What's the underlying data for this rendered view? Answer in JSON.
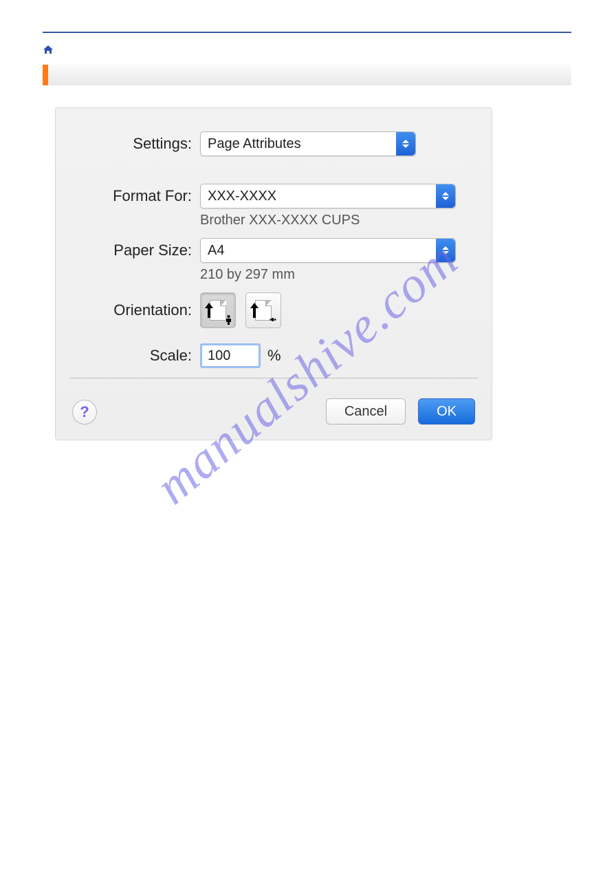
{
  "dialog": {
    "settings": {
      "label": "Settings:",
      "value": "Page Attributes"
    },
    "format": {
      "label": "Format For:",
      "value": "XXX-XXXX",
      "sub": "Brother XXX-XXXX   CUPS"
    },
    "paper": {
      "label": "Paper Size:",
      "value": "A4",
      "sub": "210 by 297 mm"
    },
    "orientation": {
      "label": "Orientation:"
    },
    "scale": {
      "label": "Scale:",
      "value": "100",
      "unit": "%"
    },
    "help_glyph": "?",
    "cancel": "Cancel",
    "ok": "OK"
  },
  "watermark": "manualshive.com"
}
